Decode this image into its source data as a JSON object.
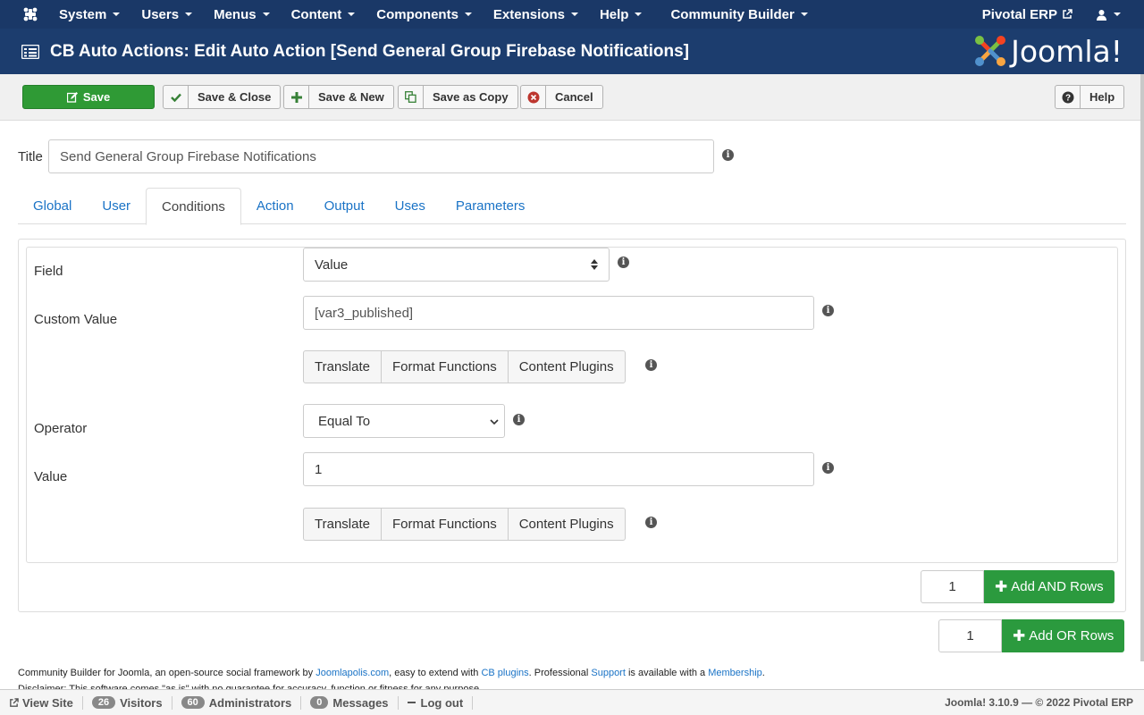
{
  "topnav": {
    "menus": [
      "System",
      "Users",
      "Menus",
      "Content",
      "Components",
      "Extensions",
      "Help",
      "Community Builder"
    ],
    "site_name": "Pivotal ERP"
  },
  "header": {
    "title": "CB Auto Actions: Edit Auto Action [Send General Group Firebase Notifications]",
    "brand": "Joomla!"
  },
  "toolbar": {
    "save": "Save",
    "save_close": "Save & Close",
    "save_new": "Save & New",
    "save_copy": "Save as Copy",
    "cancel": "Cancel",
    "help": "Help"
  },
  "form": {
    "title_label": "Title",
    "title_value": "Send General Group Firebase Notifications"
  },
  "tabs": [
    "Global",
    "User",
    "Conditions",
    "Action",
    "Output",
    "Uses",
    "Parameters"
  ],
  "active_tab": "Conditions",
  "conditions": {
    "field_label": "Field",
    "field_value": "Value",
    "custom_value_label": "Custom Value",
    "custom_value": "[var3_published]",
    "operator_label": "Operator",
    "operator_value": "Equal To",
    "value_label": "Value",
    "value": "1",
    "buttons": [
      "Translate",
      "Format Functions",
      "Content Plugins"
    ]
  },
  "add_and": {
    "count": "1",
    "label": "Add AND Rows"
  },
  "add_or": {
    "count": "1",
    "label": "Add OR Rows"
  },
  "footer": {
    "line1_a": "Community Builder for Joomla, an open-source social framework by ",
    "link_joomlapolis": "Joomlapolis.com",
    "line1_b": ", easy to extend with ",
    "link_cb_plugins": "CB plugins",
    "line1_c": ". Professional ",
    "link_support": "Support",
    "line1_d": " is available with a ",
    "link_membership": "Membership",
    "line1_e": ".",
    "line2": "Disclaimer: This software comes \"as is\" with no guarantee for accuracy, function or fitness for any purpose."
  },
  "statusbar": {
    "view_site": "View Site",
    "visitors_count": "26",
    "visitors": "Visitors",
    "admins_count": "60",
    "admins": "Administrators",
    "messages_count": "0",
    "messages": "Messages",
    "logout": "Log out",
    "version": "Joomla! 3.10.9 — © 2022 Pivotal ERP"
  },
  "colors": {
    "nav": "#1a3867",
    "save_green": "#2f9a35",
    "link": "#1a73c6"
  }
}
